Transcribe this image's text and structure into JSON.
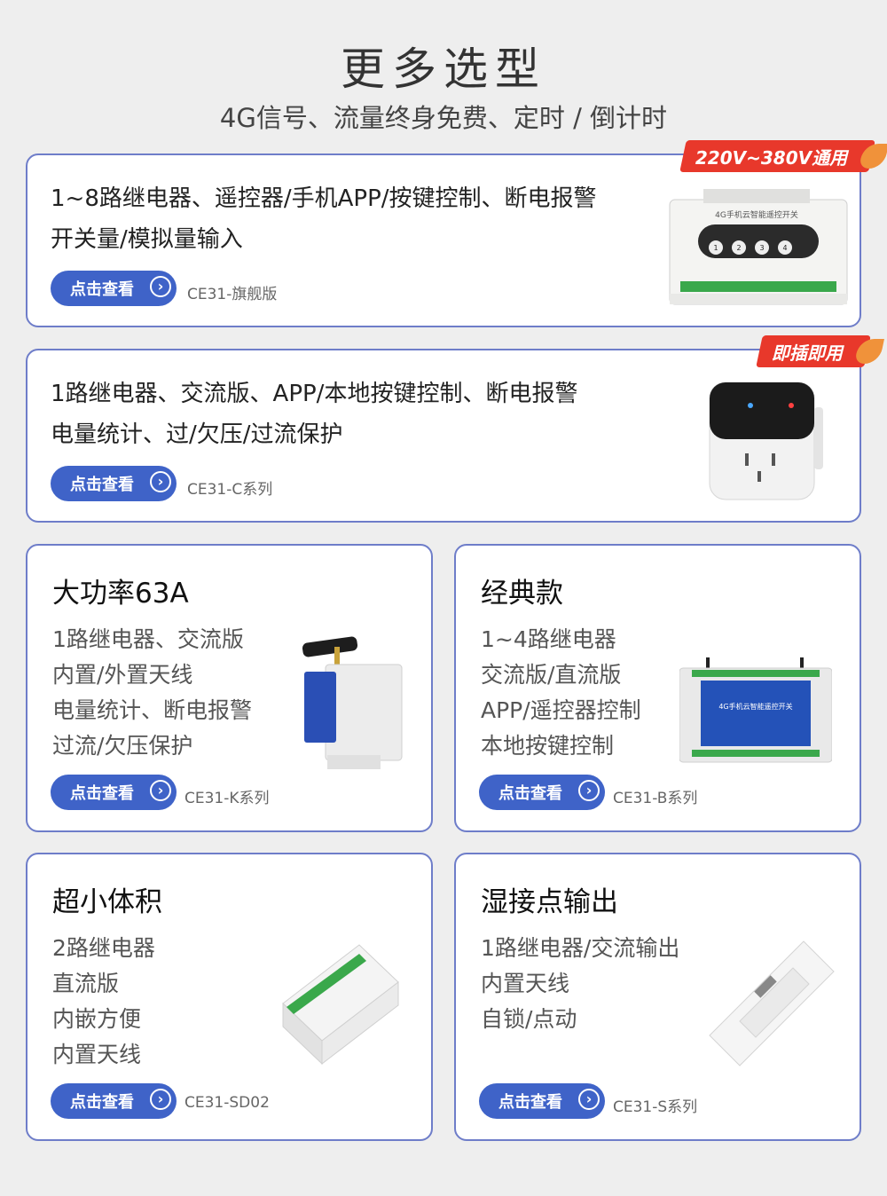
{
  "page": {
    "title": "更多选型",
    "subtitle": "4G信号、流量终身免费、定时 / 倒计时"
  },
  "cards": {
    "c1": {
      "line1": "1~8路继电器、遥控器/手机APP/按键控制、断电报警",
      "line2": "开关量/模拟量输入",
      "button": "点击查看",
      "model": "CE31-旗舰版",
      "badge": "220V~380V通用",
      "product": {
        "device_label": "4G手机云智能遥控开关",
        "keys": [
          "1",
          "2",
          "3",
          "4"
        ]
      }
    },
    "c2": {
      "line1": "1路继电器、交流版、APP/本地按键控制、断电报警",
      "line2": "电量统计、过/欠压/过流保护",
      "button": "点击查看",
      "model": "CE31-C系列",
      "badge": "即插即用"
    },
    "c3": {
      "head": "大功率63A",
      "features": [
        "1路继电器、交流版",
        "内置/外置天线",
        "电量统计、断电报警",
        "过流/欠压保护"
      ],
      "button": "点击查看",
      "model": "CE31-K系列"
    },
    "c4": {
      "head": "经典款",
      "features": [
        "1~4路继电器",
        "交流版/直流版",
        "APP/遥控器控制",
        "本地按键控制"
      ],
      "button": "点击查看",
      "model": "CE31-B系列",
      "product": {
        "device_label": "4G手机云智能遥控开关"
      }
    },
    "c5": {
      "head": "超小体积",
      "features": [
        "2路继电器",
        "直流版",
        "内嵌方便",
        "内置天线"
      ],
      "button": "点击查看",
      "model": "CE31-SD02"
    },
    "c6": {
      "head": "湿接点输出",
      "features": [
        "1路继电器/交流输出",
        "内置天线",
        "自锁/点动"
      ],
      "button": "点击查看",
      "model": "CE31-S系列"
    }
  },
  "colors": {
    "accent": "#3f63c8",
    "border": "#6e7dc9",
    "badge": "#e8382b",
    "background": "#eeeeee"
  },
  "icons": {
    "button_arrow": "chevron-right-circle-icon"
  }
}
